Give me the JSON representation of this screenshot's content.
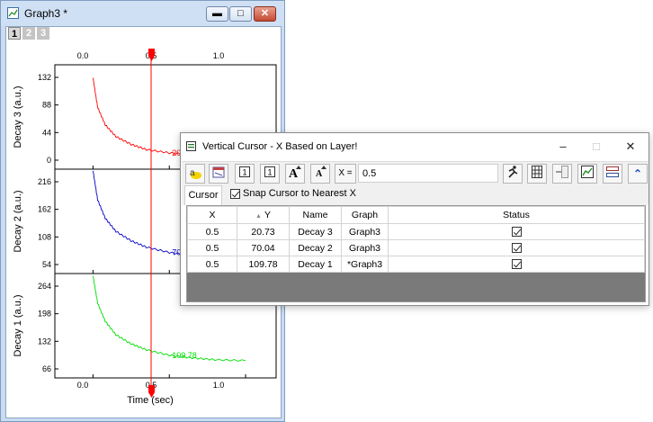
{
  "graph_window": {
    "title": "Graph3 *",
    "layer_tabs": [
      "1",
      "2",
      "3"
    ],
    "top_axis_ticks": [
      "0.0",
      "0.5",
      "1.0"
    ],
    "bottom_axis_ticks": [
      "0.0",
      "0.5",
      "1.0"
    ],
    "xlabel": "Time (sec)"
  },
  "chart_data": [
    {
      "type": "line",
      "ylabel": "Decay 3 (a.u.)",
      "yticks": [
        "132",
        "88",
        "44",
        "0"
      ],
      "ylim": [
        0,
        160
      ],
      "xlim": [
        -0.25,
        1.2
      ],
      "color": "#ff0000",
      "series": [
        {
          "x": [
            0,
            0.03,
            0.08,
            0.15,
            0.25,
            0.35,
            0.5,
            0.65,
            0.8,
            1.0
          ],
          "y": [
            140,
            95,
            68,
            50,
            38,
            30,
            25,
            22,
            20,
            18
          ]
        }
      ],
      "cursor_label": "20.73"
    },
    {
      "type": "line",
      "ylabel": "Decay 2 (a.u.)",
      "yticks": [
        "216",
        "162",
        "108",
        "54"
      ],
      "ylim": [
        30,
        228
      ],
      "xlim": [
        -0.25,
        1.2
      ],
      "color": "#0000cc",
      "series": [
        {
          "x": [
            0,
            0.03,
            0.08,
            0.15,
            0.25,
            0.35,
            0.5,
            0.65,
            0.8,
            1.0
          ],
          "y": [
            225,
            170,
            135,
            110,
            92,
            80,
            70,
            64,
            60,
            56
          ]
        }
      ],
      "cursor_label": "70.04"
    },
    {
      "type": "line",
      "ylabel": "Decay 1 (a.u.)",
      "yticks": [
        "264",
        "198",
        "132",
        "66"
      ],
      "ylim": [
        60,
        290
      ],
      "xlim": [
        -0.25,
        1.2
      ],
      "color": "#00dd00",
      "series": [
        {
          "x": [
            0,
            0.03,
            0.08,
            0.15,
            0.25,
            0.35,
            0.5,
            0.65,
            0.8,
            1.0
          ],
          "y": [
            285,
            225,
            185,
            155,
            135,
            122,
            110,
            104,
            100,
            98
          ]
        }
      ],
      "cursor_label": "109.78"
    }
  ],
  "cursor_x": 0.5,
  "colors": {
    "cursor_line": "#ff0000",
    "grid_bg": "#7a7a7a"
  },
  "cursor_window": {
    "title": "Vertical Cursor - X Based on Layer!",
    "x_label": "X =",
    "x_value": "0.5",
    "tab": "Cursor",
    "snap_label": "Snap Cursor to Nearest X",
    "columns": [
      "X",
      "Y",
      "Name",
      "Graph",
      "Status"
    ],
    "rows": [
      {
        "x": "0.5",
        "y": "20.73",
        "name": "Decay 3",
        "graph": "Graph3",
        "status": true
      },
      {
        "x": "0.5",
        "y": "70.04",
        "name": "Decay 2",
        "graph": "Graph3",
        "status": true
      },
      {
        "x": "0.5",
        "y": "109.78",
        "name": "Decay 1",
        "graph": "*Graph3",
        "status": true
      }
    ]
  }
}
